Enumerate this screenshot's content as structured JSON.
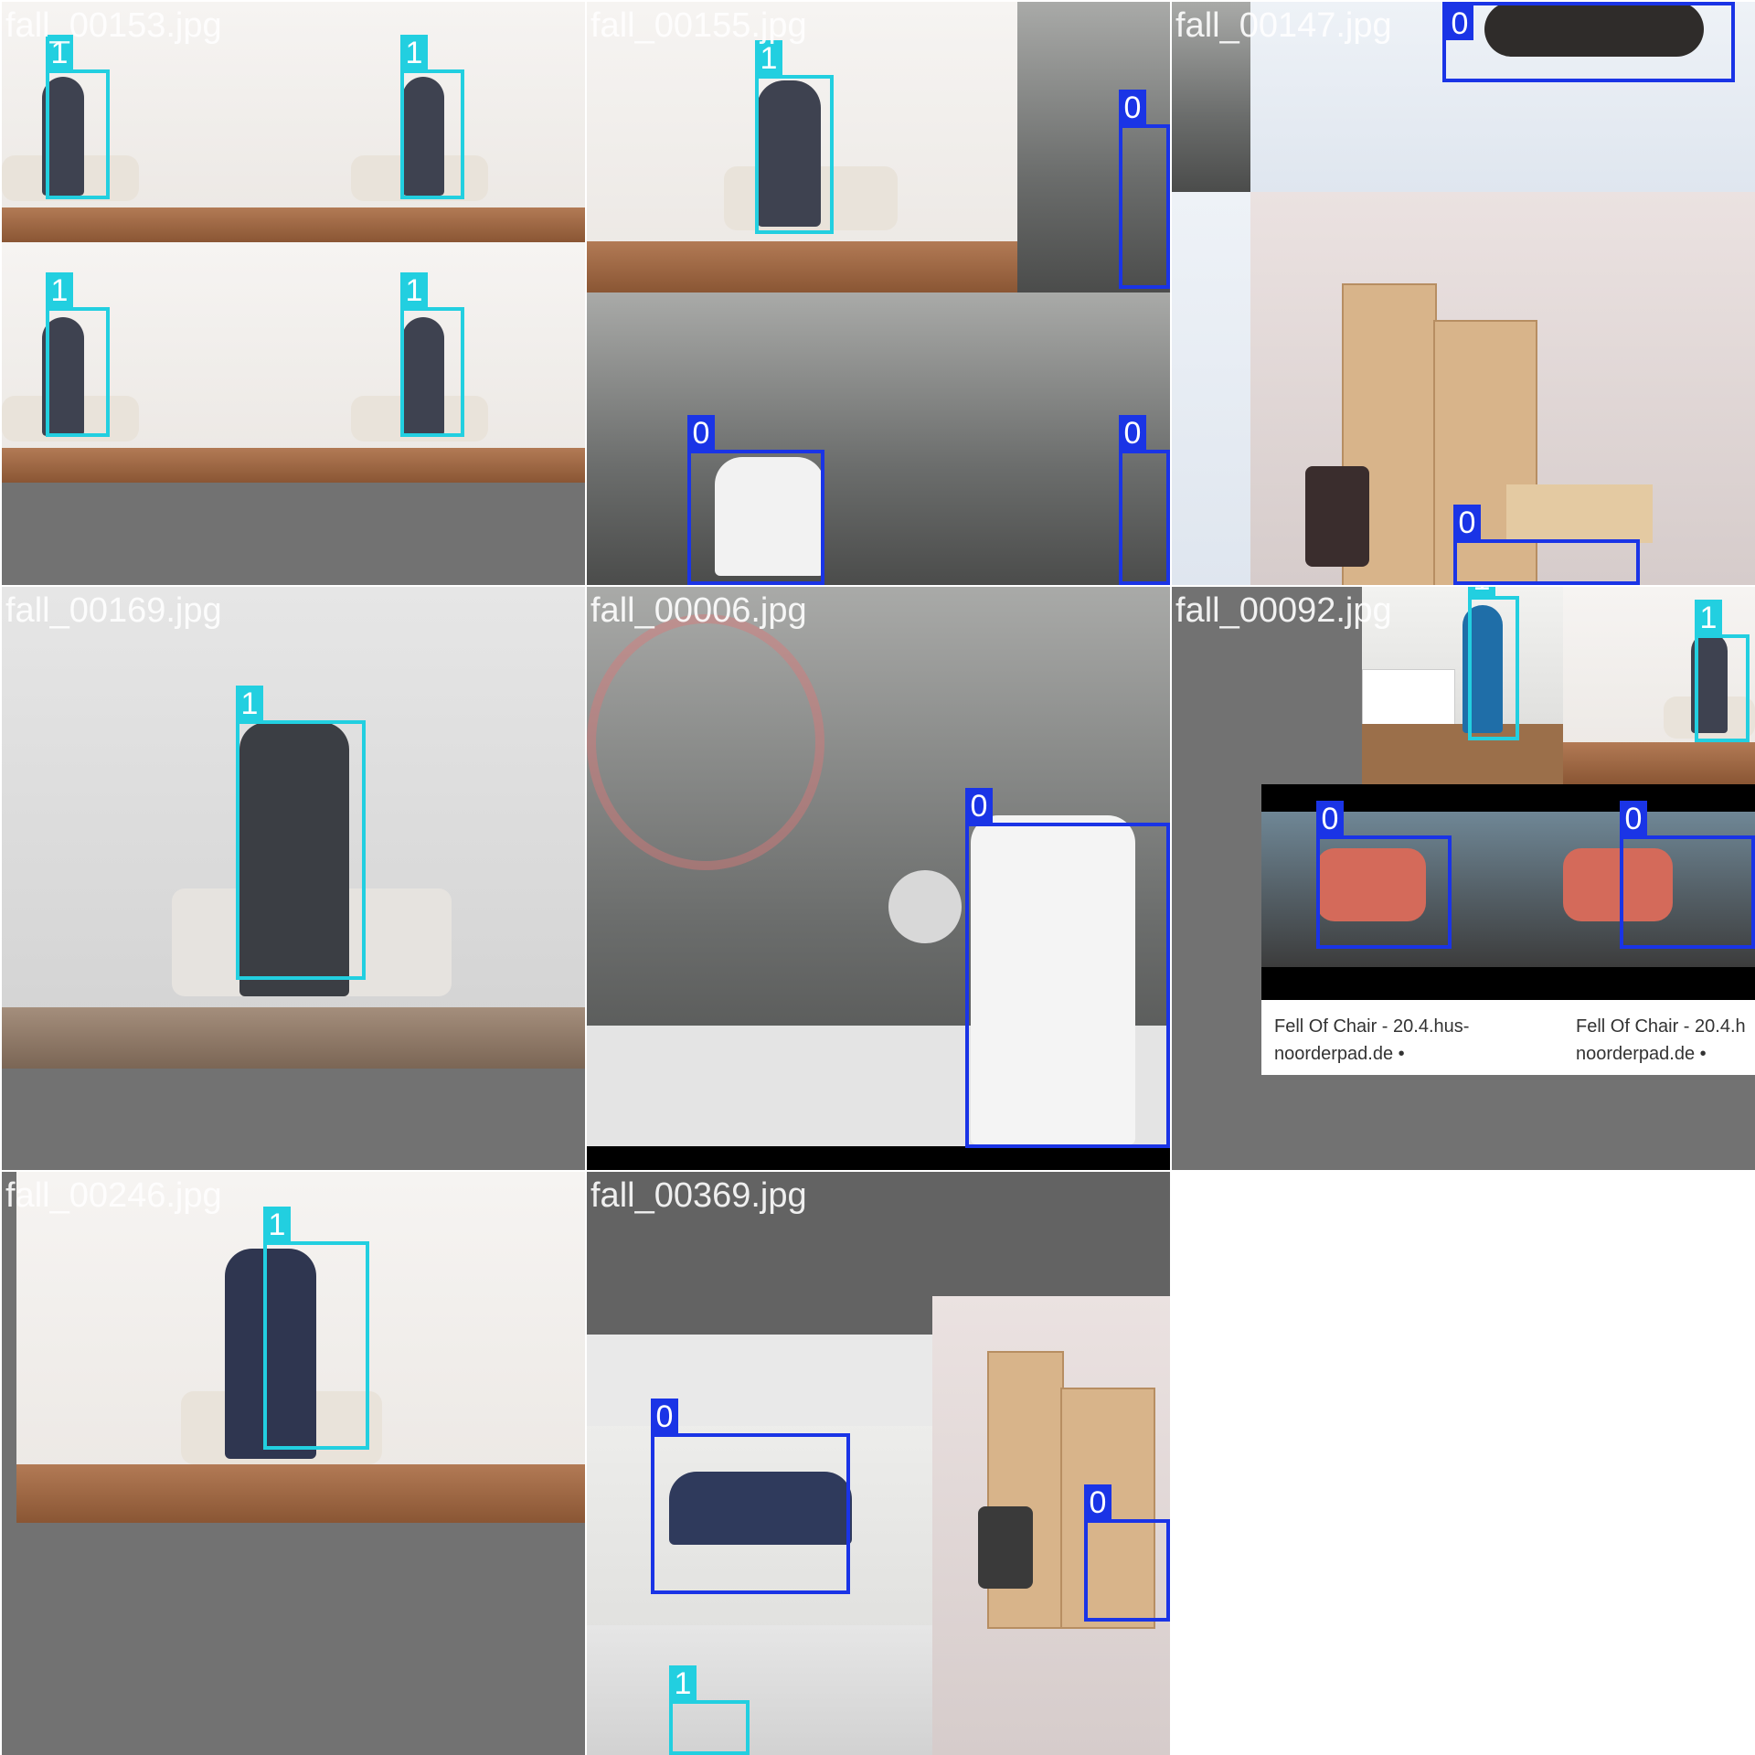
{
  "tiles": [
    {
      "filename": "fall_00153.jpg"
    },
    {
      "filename": "fall_00155.jpg"
    },
    {
      "filename": "fall_00147.jpg"
    },
    {
      "filename": "fall_00169.jpg"
    },
    {
      "filename": "fall_00006.jpg"
    },
    {
      "filename": "fall_00092.jpg"
    },
    {
      "filename": "fall_00246.jpg"
    },
    {
      "filename": "fall_00369.jpg"
    }
  ],
  "class_labels": {
    "fall": "0",
    "person": "1"
  },
  "colors": {
    "class0": "#1a34e6",
    "class1": "#22cfe0",
    "pad": "#727272"
  },
  "captions": {
    "left": "Fell Of Chair - 20.4.hus-\nnoorderpad.de •",
    "right": "Fell Of Chair - 20.4.h\nnoorderpad.de •"
  }
}
